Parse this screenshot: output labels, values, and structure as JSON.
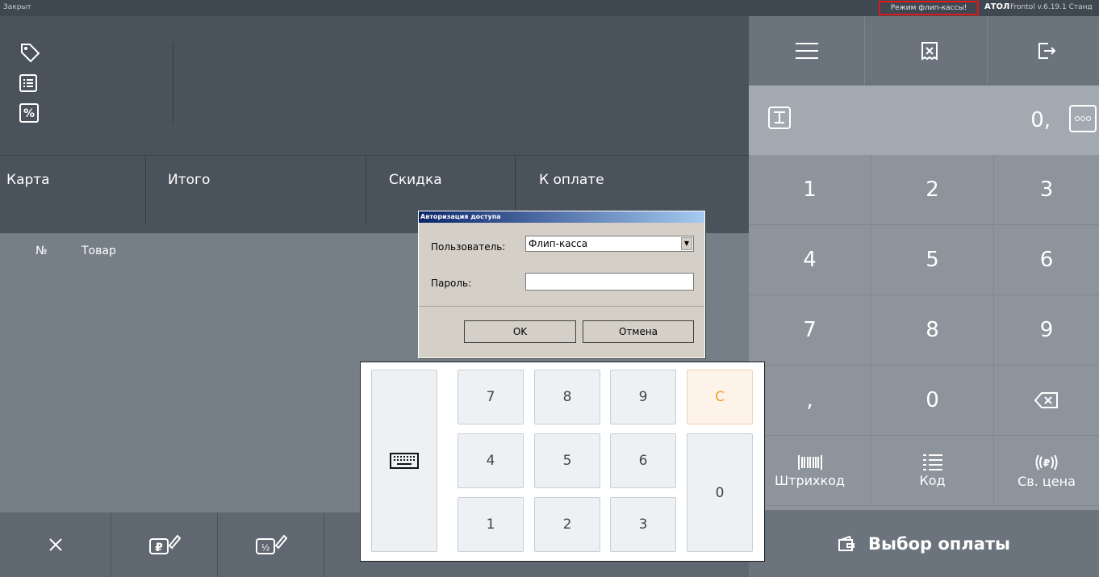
{
  "status_bar": {
    "shift_state": "Закрыт",
    "mode_badge": "Режим флип-кассы!",
    "brand": "АТОЛ",
    "version": "Frontol v.6.19.1 Станд"
  },
  "totals": {
    "card": "Карта",
    "total": "Итого",
    "discount": "Скидка",
    "to_pay": "К оплате"
  },
  "list": {
    "col_num": "№",
    "col_product": "Товар"
  },
  "right_panel": {
    "input_value": "0,",
    "keys": [
      "1",
      "2",
      "3",
      "4",
      "5",
      "6",
      "7",
      "8",
      "9",
      ",",
      "0"
    ],
    "barcode_label": "Штрихкод",
    "code_label": "Код",
    "free_price_label": "Св. цена",
    "pay_button": "Выбор оплаты"
  },
  "dialog": {
    "title": "Авторизация доступа",
    "user_label": "Пользователь:",
    "user_value": "Флип-касса",
    "password_label": "Пароль:",
    "ok": "OK",
    "cancel": "Отмена"
  },
  "numpad": {
    "keys": [
      "7",
      "8",
      "9",
      "4",
      "5",
      "6",
      "1",
      "2",
      "3"
    ],
    "clear": "C",
    "zero": "0"
  },
  "colors": {
    "alert_border": "#e01a1a",
    "clear_key": "#f39c34"
  }
}
